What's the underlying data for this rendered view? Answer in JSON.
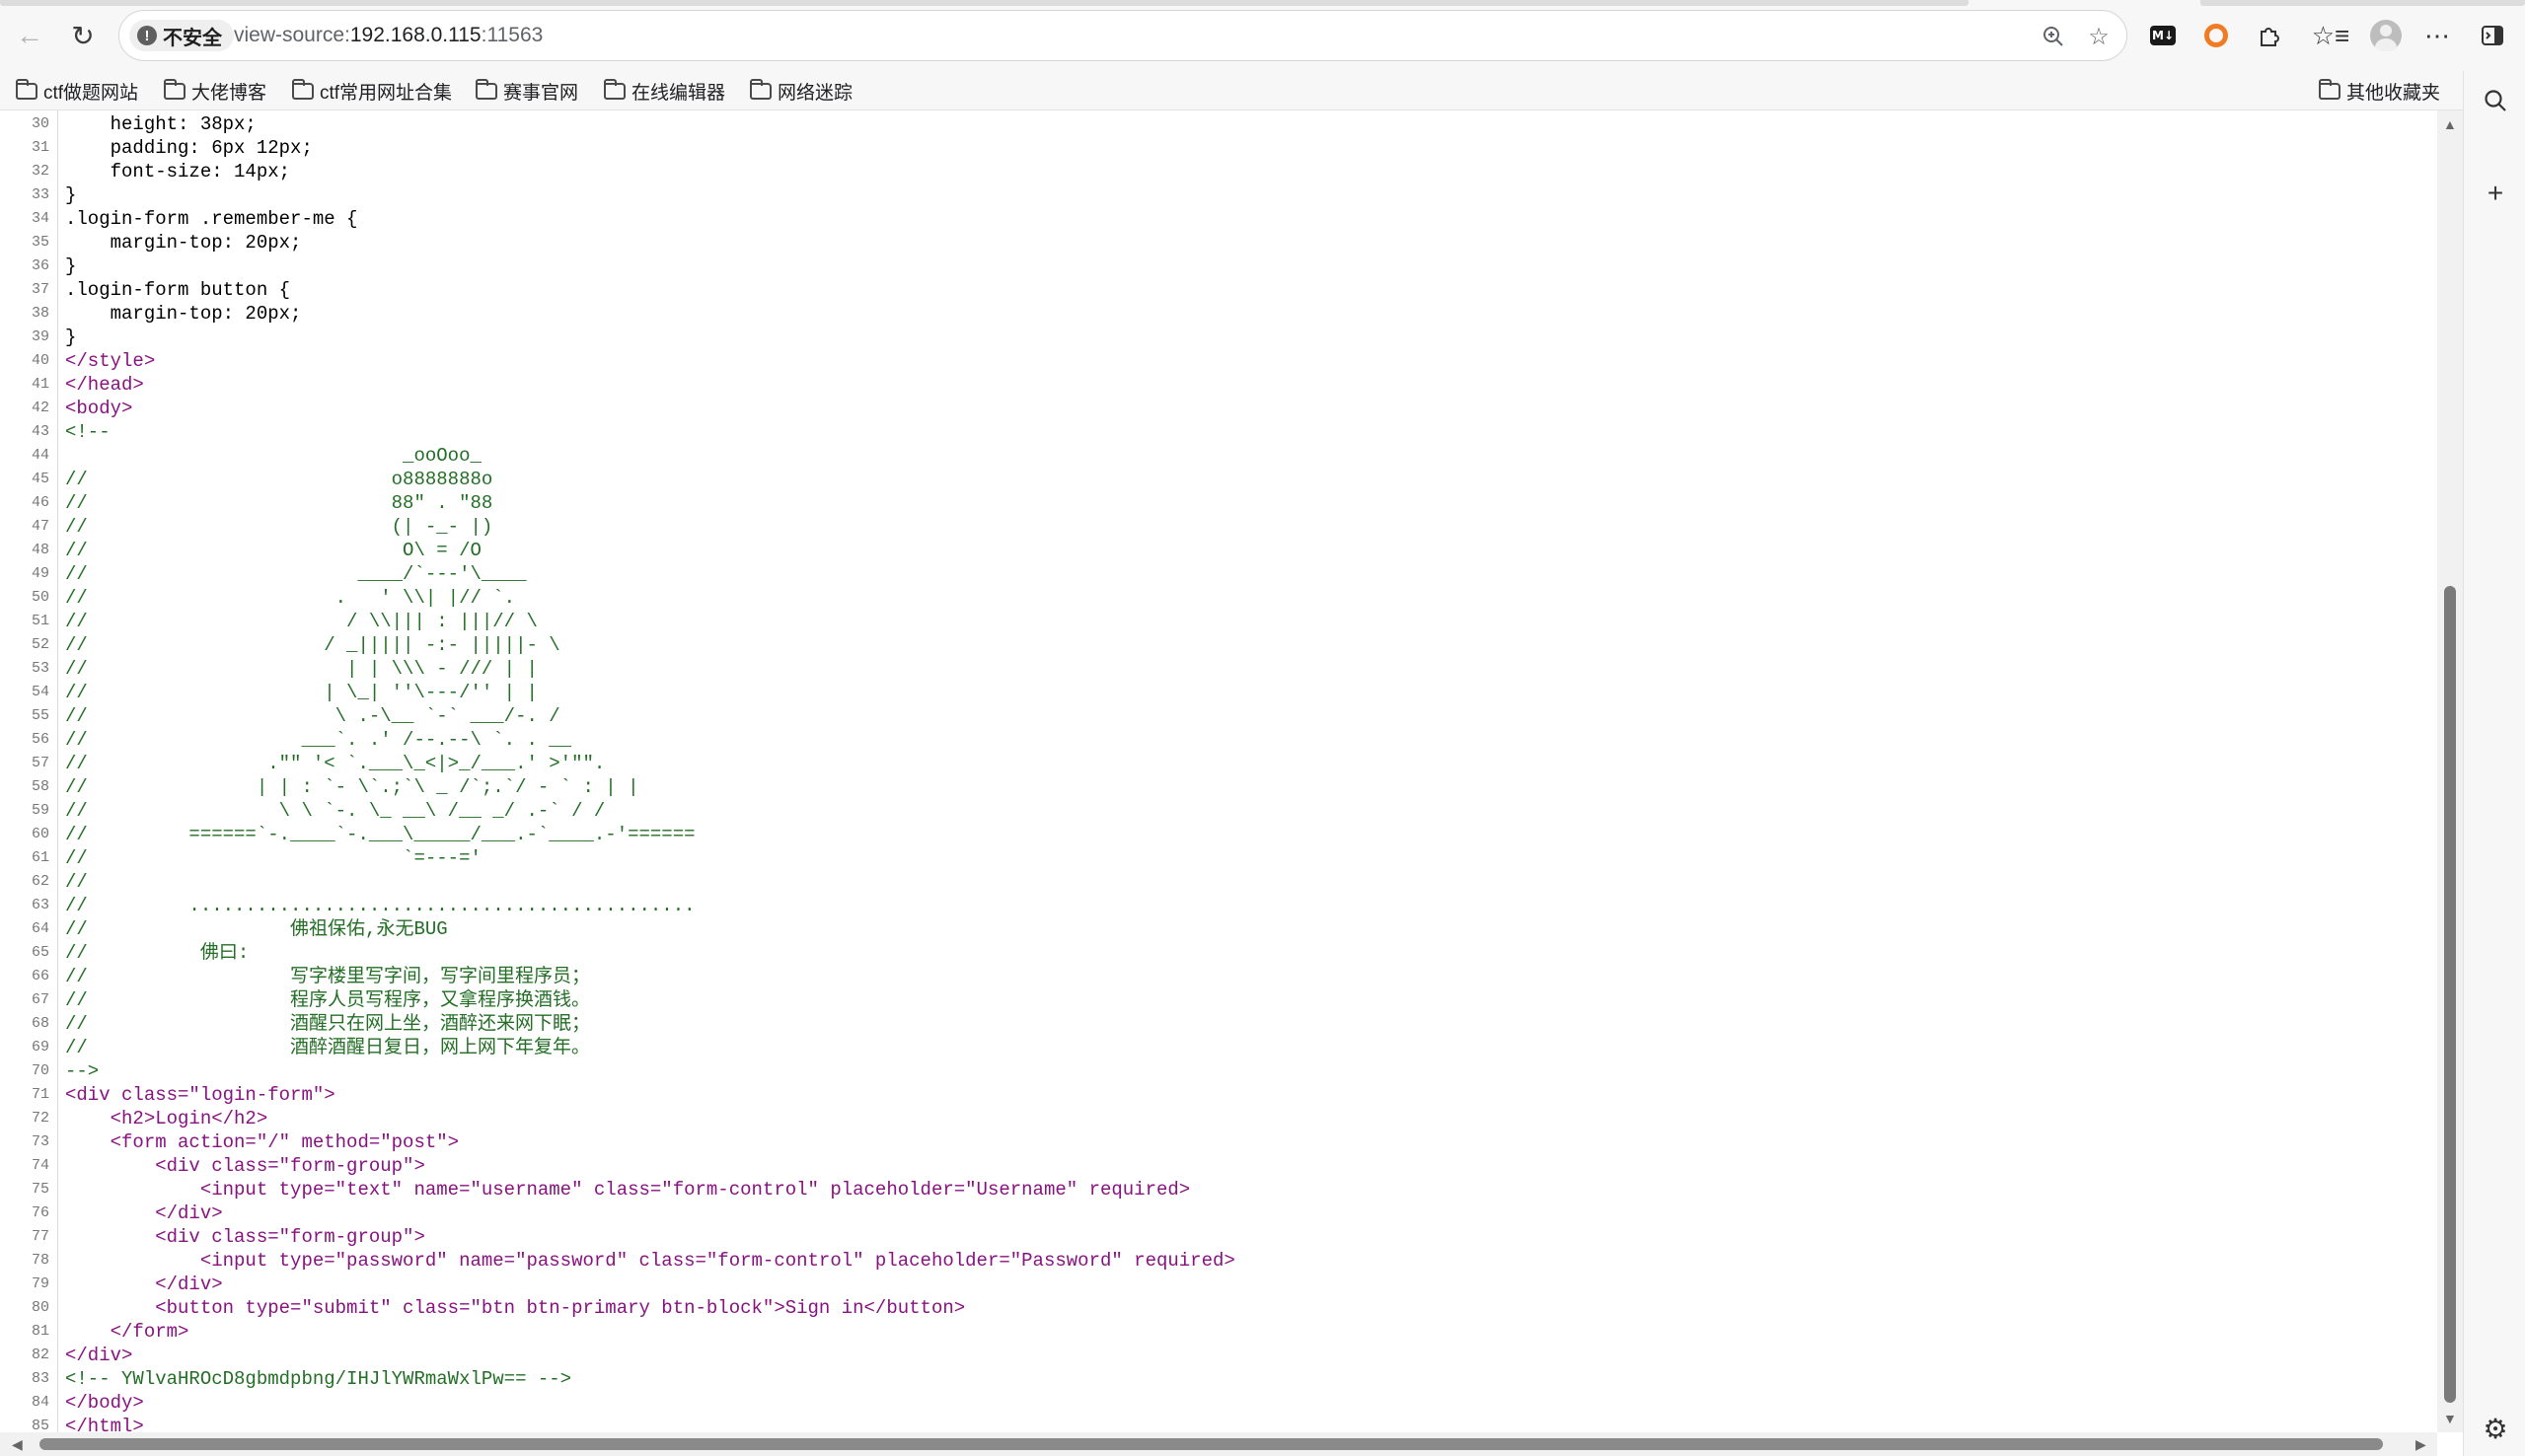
{
  "browser": {
    "security_label": "不安全",
    "url_scheme": "view-source:",
    "url_host": "192.168.0.115",
    "url_port": ":11563"
  },
  "bookmarks": [
    {
      "label": "ctf做题网站"
    },
    {
      "label": "大佬博客"
    },
    {
      "label": "ctf常用网址合集"
    },
    {
      "label": "赛事官网"
    },
    {
      "label": "在线编辑器"
    },
    {
      "label": "网络迷踪"
    }
  ],
  "other_bookmarks": "其他收藏夹",
  "source_lines": [
    {
      "n": "30",
      "t": "    height: 38px;"
    },
    {
      "n": "31",
      "t": "    padding: 6px 12px;"
    },
    {
      "n": "32",
      "t": "    font-size: 14px;"
    },
    {
      "n": "33",
      "t": "}"
    },
    {
      "n": "34",
      "t": ".login-form .remember-me {"
    },
    {
      "n": "35",
      "t": "    margin-top: 20px;"
    },
    {
      "n": "36",
      "t": "}"
    },
    {
      "n": "37",
      "t": ".login-form button {"
    },
    {
      "n": "38",
      "t": "    margin-top: 20px;"
    },
    {
      "n": "39",
      "t": "}"
    },
    {
      "n": "40",
      "t": "</style>"
    },
    {
      "n": "41",
      "t": "</head>"
    },
    {
      "n": "42",
      "t": "<body>"
    },
    {
      "n": "43",
      "t": "<!--"
    },
    {
      "n": "44",
      "t": "                              _ooOoo_"
    },
    {
      "n": "45",
      "t": "//                           o8888888o"
    },
    {
      "n": "46",
      "t": "//                           88\" . \"88"
    },
    {
      "n": "47",
      "t": "//                           (| -_- |)"
    },
    {
      "n": "48",
      "t": "//                            O\\ = /O"
    },
    {
      "n": "49",
      "t": "//                        ____/`---'\\____"
    },
    {
      "n": "50",
      "t": "//                      .   ' \\\\| |// `."
    },
    {
      "n": "51",
      "t": "//                       / \\\\||| : |||// \\"
    },
    {
      "n": "52",
      "t": "//                     / _||||| -:- |||||- \\"
    },
    {
      "n": "53",
      "t": "//                       | | \\\\\\ - /// | |"
    },
    {
      "n": "54",
      "t": "//                     | \\_| ''\\---/'' | |"
    },
    {
      "n": "55",
      "t": "//                      \\ .-\\__ `-` ___/-. /"
    },
    {
      "n": "56",
      "t": "//                   ___`. .' /--.--\\ `. . __"
    },
    {
      "n": "57",
      "t": "//                .\"\" '< `.___\\_<|>_/___.' >'\"\"."
    },
    {
      "n": "58",
      "t": "//               | | : `- \\`.;`\\ _ /`;.`/ - ` : | |"
    },
    {
      "n": "59",
      "t": "//                 \\ \\ `-. \\_ __\\ /__ _/ .-` / /"
    },
    {
      "n": "60",
      "t": "//         ======`-.____`-.___\\_____/___.-`____.-'======"
    },
    {
      "n": "61",
      "t": "//                            `=---='"
    },
    {
      "n": "62",
      "t": "//"
    },
    {
      "n": "63",
      "t": "//         ............................................."
    },
    {
      "n": "64",
      "t": "//                  佛祖保佑,永无BUG"
    },
    {
      "n": "65",
      "t": "//          佛曰:"
    },
    {
      "n": "66",
      "t": "//                  写字楼里写字间，写字间里程序员；"
    },
    {
      "n": "67",
      "t": "//                  程序人员写程序，又拿程序换酒钱。"
    },
    {
      "n": "68",
      "t": "//                  酒醒只在网上坐，酒醉还来网下眠；"
    },
    {
      "n": "69",
      "t": "//                  酒醉酒醒日复日，网上网下年复年。"
    },
    {
      "n": "70",
      "t": "-->"
    },
    {
      "n": "71",
      "t": "<div class=\"login-form\">"
    },
    {
      "n": "72",
      "t": "    <h2>Login</h2>"
    },
    {
      "n": "73",
      "t": "    <form action=\"/\" method=\"post\">"
    },
    {
      "n": "74",
      "t": "        <div class=\"form-group\">"
    },
    {
      "n": "75",
      "t": "            <input type=\"text\" name=\"username\" class=\"form-control\" placeholder=\"Username\" required>"
    },
    {
      "n": "76",
      "t": "        </div>"
    },
    {
      "n": "77",
      "t": "        <div class=\"form-group\">"
    },
    {
      "n": "78",
      "t": "            <input type=\"password\" name=\"password\" class=\"form-control\" placeholder=\"Password\" required>"
    },
    {
      "n": "79",
      "t": "        </div>"
    },
    {
      "n": "80",
      "t": "        <button type=\"submit\" class=\"btn btn-primary btn-block\">Sign in</button>"
    },
    {
      "n": "81",
      "t": "    </form>"
    },
    {
      "n": "82",
      "t": "</div>"
    },
    {
      "n": "83",
      "t": "<!-- YWlvaHROcD8gbmdpbng/IHJlYWRmaWxlPw== -->"
    },
    {
      "n": "84",
      "t": "</body>"
    },
    {
      "n": "85",
      "t": "</html>"
    }
  ],
  "icons": [
    "back-icon",
    "reload-icon",
    "warning-icon",
    "zoom-icon",
    "star-icon",
    "markdown-extension-icon",
    "orange-extension-icon",
    "extensions-icon",
    "favorites-icon",
    "profile-icon",
    "more-icon",
    "sidebar-icon",
    "search-icon",
    "add-icon",
    "settings-icon"
  ]
}
